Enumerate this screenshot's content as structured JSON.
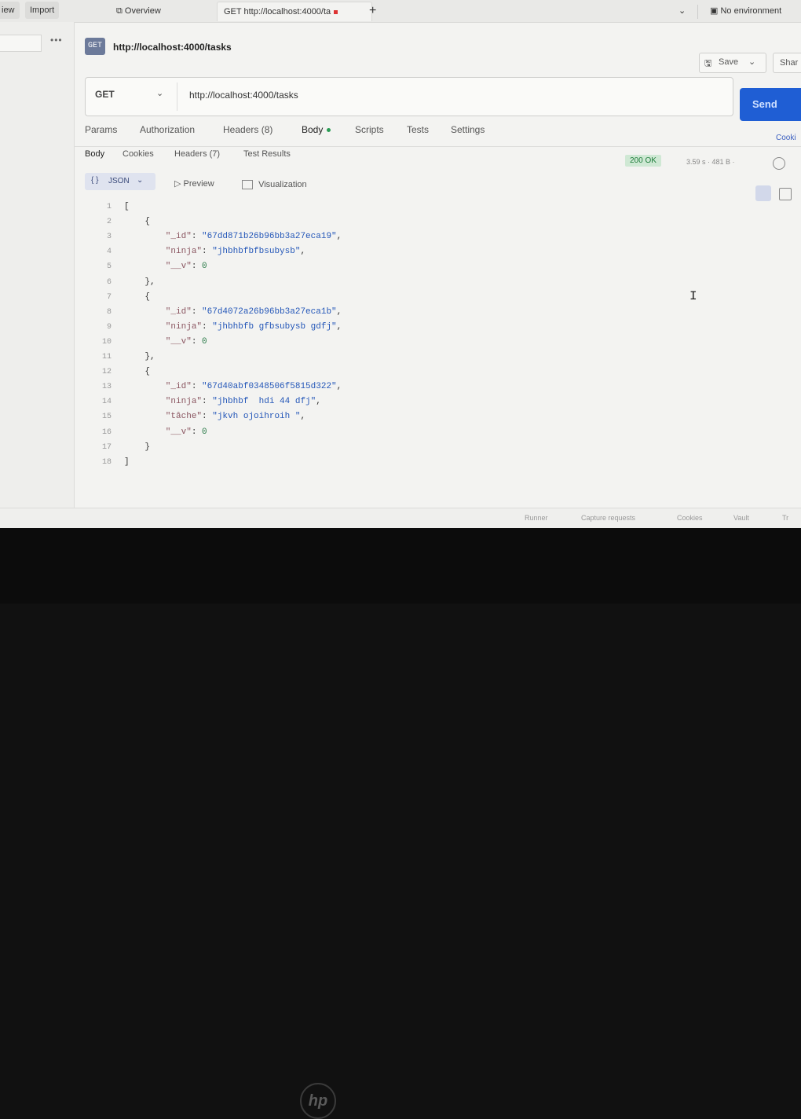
{
  "app": {
    "left_buttons": [
      "iew",
      "Import"
    ],
    "tabs": [
      {
        "label": "Overview",
        "icon": "overview-icon"
      },
      {
        "label": "GET http://localhost:4000/ta",
        "unsaved": true
      }
    ],
    "new_tab": "+",
    "environment": "No environment"
  },
  "request": {
    "title": "http://localhost:4000/tasks",
    "save_label": "Save",
    "share_label": "Shar",
    "method": "GET",
    "url": "http://localhost:4000/tasks",
    "send_label": "Send",
    "tabs": [
      {
        "label": "Params"
      },
      {
        "label": "Authorization"
      },
      {
        "label": "Headers (8)"
      },
      {
        "label": "Body",
        "active": true
      },
      {
        "label": "Scripts"
      },
      {
        "label": "Tests"
      },
      {
        "label": "Settings"
      }
    ],
    "cookies_link": "Cooki"
  },
  "response": {
    "tabs": [
      "Body",
      "Cookies",
      "Headers (7)",
      "Test Results"
    ],
    "status": "200 OK",
    "meta": "3.59 s · 481 B ·",
    "view": {
      "format": "JSON",
      "preview": "Preview",
      "visualization": "Visualization"
    },
    "lines": [
      {
        "n": "1",
        "segs": [
          {
            "t": "[",
            "c": "p"
          }
        ]
      },
      {
        "n": "2",
        "segs": [
          {
            "t": "    {",
            "c": "p"
          }
        ]
      },
      {
        "n": "3",
        "segs": [
          {
            "t": "        \"_id\"",
            "c": "k"
          },
          {
            "t": ": ",
            "c": "p"
          },
          {
            "t": "\"67dd871b26b96bb3a27eca19\"",
            "c": "s"
          },
          {
            "t": ",",
            "c": "p"
          }
        ]
      },
      {
        "n": "4",
        "segs": [
          {
            "t": "        \"ninja\"",
            "c": "k"
          },
          {
            "t": ": ",
            "c": "p"
          },
          {
            "t": "\"jhbhbfbfbsubysb\"",
            "c": "s"
          },
          {
            "t": ",",
            "c": "p"
          }
        ]
      },
      {
        "n": "5",
        "segs": [
          {
            "t": "        \"__v\"",
            "c": "k"
          },
          {
            "t": ": ",
            "c": "p"
          },
          {
            "t": "0",
            "c": "n"
          }
        ]
      },
      {
        "n": "6",
        "segs": [
          {
            "t": "    },",
            "c": "p"
          }
        ]
      },
      {
        "n": "7",
        "segs": [
          {
            "t": "    {",
            "c": "p"
          }
        ]
      },
      {
        "n": "8",
        "segs": [
          {
            "t": "        \"_id\"",
            "c": "k"
          },
          {
            "t": ": ",
            "c": "p"
          },
          {
            "t": "\"67d4072a26b96bb3a27eca1b\"",
            "c": "s"
          },
          {
            "t": ",",
            "c": "p"
          }
        ]
      },
      {
        "n": "9",
        "segs": [
          {
            "t": "        \"ninja\"",
            "c": "k"
          },
          {
            "t": ": ",
            "c": "p"
          },
          {
            "t": "\"jhbhbfb gfbsubysb gdfj\"",
            "c": "s"
          },
          {
            "t": ",",
            "c": "p"
          }
        ]
      },
      {
        "n": "10",
        "segs": [
          {
            "t": "        \"__v\"",
            "c": "k"
          },
          {
            "t": ": ",
            "c": "p"
          },
          {
            "t": "0",
            "c": "n"
          }
        ]
      },
      {
        "n": "11",
        "segs": [
          {
            "t": "    },",
            "c": "p"
          }
        ]
      },
      {
        "n": "12",
        "segs": [
          {
            "t": "    {",
            "c": "p"
          }
        ]
      },
      {
        "n": "13",
        "segs": [
          {
            "t": "        \"_id\"",
            "c": "k"
          },
          {
            "t": ": ",
            "c": "p"
          },
          {
            "t": "\"67d40abf0348506f5815d322\"",
            "c": "s"
          },
          {
            "t": ",",
            "c": "p"
          }
        ]
      },
      {
        "n": "14",
        "segs": [
          {
            "t": "        \"ninja\"",
            "c": "k"
          },
          {
            "t": ": ",
            "c": "p"
          },
          {
            "t": "\"jhbhbf  hdi 44 dfj\"",
            "c": "s"
          },
          {
            "t": ",",
            "c": "p"
          }
        ]
      },
      {
        "n": "15",
        "segs": [
          {
            "t": "        \"tâche\"",
            "c": "k"
          },
          {
            "t": ": ",
            "c": "p"
          },
          {
            "t": "\"jkvh ojoihroih \"",
            "c": "s"
          },
          {
            "t": ",",
            "c": "p"
          }
        ]
      },
      {
        "n": "16",
        "segs": [
          {
            "t": "        \"__v\"",
            "c": "k"
          },
          {
            "t": ": ",
            "c": "p"
          },
          {
            "t": "0",
            "c": "n"
          }
        ]
      },
      {
        "n": "17",
        "segs": [
          {
            "t": "    }",
            "c": "p"
          }
        ]
      },
      {
        "n": "18",
        "segs": [
          {
            "t": "]",
            "c": "p"
          }
        ]
      }
    ]
  },
  "footer": [
    "Runner",
    "Capture requests",
    "Cookies",
    "Vault",
    "Tr"
  ],
  "hardware": {
    "logo": "hp"
  },
  "colors": {
    "send": "#1f5ed4",
    "status_ok": "#1f7d3b",
    "json_string": "#2356b8",
    "json_key": "#8a5560"
  }
}
